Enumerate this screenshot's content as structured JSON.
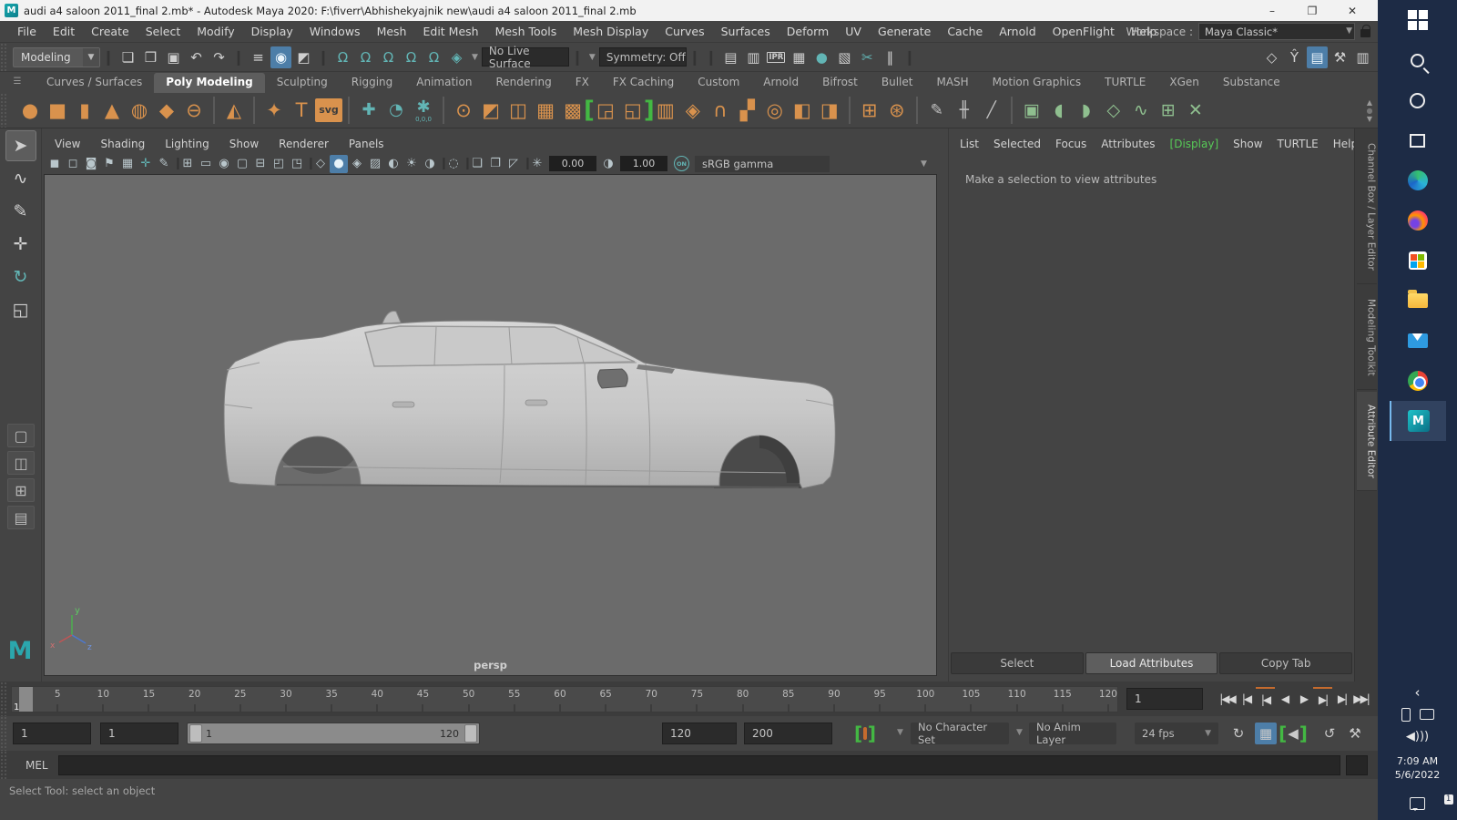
{
  "window": {
    "title": "audi a4 saloon 2011_final 2.mb* - Autodesk Maya 2020: F:\\fiverr\\Abhishekyajnik new\\audi a4 saloon 2011_final 2.mb",
    "minimize": "–",
    "maximize": "❐",
    "close": "✕"
  },
  "menu_bar": {
    "items": [
      "File",
      "Edit",
      "Create",
      "Select",
      "Modify",
      "Display",
      "Windows",
      "Mesh",
      "Edit Mesh",
      "Mesh Tools",
      "Mesh Display",
      "Curves",
      "Surfaces",
      "Deform",
      "UV",
      "Generate",
      "Cache",
      "Arnold",
      "OpenFlight",
      "Help"
    ],
    "workspace_label": "Workspace :",
    "workspace_value": "Maya Classic*"
  },
  "status_line": {
    "mode_selector": "Modeling",
    "file_icons": [
      {
        "name": "new-scene-icon",
        "glyph": "❏"
      },
      {
        "name": "open-scene-icon",
        "glyph": "❒"
      },
      {
        "name": "save-scene-icon",
        "glyph": "▣"
      },
      {
        "name": "undo-icon",
        "glyph": "↶"
      },
      {
        "name": "redo-icon",
        "glyph": "↷"
      }
    ],
    "selection_icons": [
      {
        "name": "select-hierarchy-icon",
        "glyph": "≡",
        "active": false
      },
      {
        "name": "select-object-icon",
        "glyph": "◉",
        "active": true
      },
      {
        "name": "select-component-icon",
        "glyph": "◩",
        "active": false
      }
    ],
    "snap_icons": [
      {
        "name": "snap-grid-icon",
        "glyph": "Ω"
      },
      {
        "name": "snap-curve-icon",
        "glyph": "Ω"
      },
      {
        "name": "snap-point-icon",
        "glyph": "Ω"
      },
      {
        "name": "snap-projected-center-icon",
        "glyph": "Ω"
      },
      {
        "name": "snap-view-plane-icon",
        "glyph": "Ω"
      },
      {
        "name": "make-live-icon",
        "glyph": "◈"
      }
    ],
    "no_live_surface": "No Live Surface",
    "symmetry": "Symmetry: Off",
    "render_icons": [
      {
        "name": "render-view-icon",
        "glyph": "▤"
      },
      {
        "name": "render-current-frame-icon",
        "glyph": "▥"
      },
      {
        "name": "ipr-render-icon",
        "glyph": "IPR"
      },
      {
        "name": "render-settings-icon",
        "glyph": "▦"
      },
      {
        "name": "display-render-settings-icon",
        "glyph": "●",
        "teal": true
      },
      {
        "name": "render-sequence-icon",
        "glyph": "▧"
      },
      {
        "name": "launch-render-setup-icon",
        "glyph": "✂",
        "teal": true
      },
      {
        "name": "pause-viewport-icon",
        "glyph": "‖"
      }
    ],
    "sidebar_icons": [
      {
        "name": "modeling-toolkit-icon",
        "glyph": "◇",
        "active": false
      },
      {
        "name": "humanik-icon",
        "glyph": "Ŷ",
        "active": false
      },
      {
        "name": "attribute-editor-icon",
        "glyph": "▤",
        "active": true
      },
      {
        "name": "tool-settings-icon",
        "glyph": "⚒",
        "active": false
      },
      {
        "name": "channel-box-icon",
        "glyph": "▥",
        "active": false
      }
    ]
  },
  "shelf": {
    "tabs": [
      "Curves / Surfaces",
      "Poly Modeling",
      "Sculpting",
      "Rigging",
      "Animation",
      "Rendering",
      "FX",
      "FX Caching",
      "Custom",
      "Arnold",
      "Bifrost",
      "Bullet",
      "MASH",
      "Motion Graphics",
      "TURTLE",
      "XGen",
      "Substance"
    ],
    "active_tab": "Poly Modeling",
    "icons": [
      {
        "name": "poly-sphere-icon",
        "glyph": "●",
        "color": "orange"
      },
      {
        "name": "poly-cube-icon",
        "glyph": "■",
        "color": "orange"
      },
      {
        "name": "poly-cylinder-icon",
        "glyph": "▮",
        "color": "orange"
      },
      {
        "name": "poly-cone-icon",
        "glyph": "▲",
        "color": "orange"
      },
      {
        "name": "poly-torus-icon",
        "glyph": "◍",
        "color": "orange"
      },
      {
        "name": "poly-plane-icon",
        "glyph": "◆",
        "color": "orange"
      },
      {
        "name": "poly-disc-icon",
        "glyph": "⊖",
        "color": "orange"
      },
      {
        "sep": true
      },
      {
        "name": "platonic-solid-icon",
        "glyph": "◭",
        "color": "orange"
      },
      {
        "sep": true
      },
      {
        "name": "sweep-mesh-icon",
        "glyph": "✦",
        "color": "orange"
      },
      {
        "name": "poly-type-icon",
        "glyph": "T",
        "color": "orange"
      },
      {
        "name": "svg-tool-icon",
        "glyph": "svg",
        "color": "orange",
        "badge": true
      },
      {
        "sep": true
      },
      {
        "name": "construction-plane-icon",
        "glyph": "✚",
        "color": "teal"
      },
      {
        "name": "reset-transform-icon",
        "glyph": "◔",
        "color": "teal"
      },
      {
        "name": "move-to-origin-icon",
        "glyph": "✱",
        "color": "teal",
        "sub": "0,0,0"
      },
      {
        "sep": true
      },
      {
        "name": "booleans-icon",
        "glyph": "⊙",
        "color": "orange"
      },
      {
        "name": "combine-icon",
        "glyph": "◩",
        "color": "orange"
      },
      {
        "name": "mirror-icon",
        "glyph": "◫",
        "color": "orange"
      },
      {
        "name": "smooth-icon",
        "glyph": "▦",
        "color": "orange"
      },
      {
        "name": "subdivide-icon",
        "glyph": "▩",
        "color": "orange"
      },
      {
        "name": "rotate-edge-cw-icon",
        "glyph": "◲",
        "color": "orange",
        "bracket": "left"
      },
      {
        "name": "rotate-edge-ccw-icon",
        "glyph": "◱",
        "color": "orange",
        "bracket": "right"
      },
      {
        "name": "extrude-icon",
        "glyph": "▥",
        "color": "orange"
      },
      {
        "name": "bevel-icon",
        "glyph": "◈",
        "color": "orange"
      },
      {
        "name": "bridge-icon",
        "glyph": "∩",
        "color": "orange"
      },
      {
        "name": "multi-cut-icon",
        "glyph": "▞",
        "color": "orange"
      },
      {
        "name": "circularize-icon",
        "glyph": "◎",
        "color": "orange"
      },
      {
        "name": "quad-draw-icon",
        "glyph": "◧",
        "color": "orange"
      },
      {
        "name": "target-weld-icon",
        "glyph": "◨",
        "color": "orange"
      },
      {
        "sep": true
      },
      {
        "name": "lattice-icon",
        "glyph": "⊞",
        "color": "orange"
      },
      {
        "name": "soft-modification-icon",
        "glyph": "⊛",
        "color": "orange"
      },
      {
        "sep": true
      },
      {
        "name": "crease-tool-icon",
        "glyph": "✎",
        "color": "grey"
      },
      {
        "name": "edit-edge-flow-icon",
        "glyph": "╫",
        "color": "grey"
      },
      {
        "name": "insert-edge-loop-icon",
        "glyph": "╱",
        "color": "grey"
      },
      {
        "sep": true
      },
      {
        "name": "uv-planar-icon",
        "glyph": "▣",
        "color": "green"
      },
      {
        "name": "uv-cylindrical-icon",
        "glyph": "◖",
        "color": "green"
      },
      {
        "name": "uv-spherical-icon",
        "glyph": "◗",
        "color": "green"
      },
      {
        "name": "uv-automatic-icon",
        "glyph": "◇",
        "color": "green"
      },
      {
        "name": "uv-contour-stretch-icon",
        "glyph": "∿",
        "color": "green"
      },
      {
        "name": "uv-editor-icon",
        "glyph": "⊞",
        "color": "green"
      },
      {
        "name": "uv-cut-sew-icon",
        "glyph": "✕",
        "color": "green"
      }
    ]
  },
  "toolbox": {
    "tools": [
      {
        "name": "select-tool",
        "glyph": "➤",
        "active": true
      },
      {
        "name": "lasso-tool",
        "glyph": "∿",
        "active": false
      },
      {
        "name": "paint-select-tool",
        "glyph": "✎",
        "active": false
      },
      {
        "name": "move-tool",
        "glyph": "✛",
        "active": false
      },
      {
        "name": "rotate-tool",
        "glyph": "↻",
        "active": false,
        "teal": true
      },
      {
        "name": "scale-tool",
        "glyph": "◱",
        "active": false
      }
    ],
    "layout_buttons": [
      {
        "name": "pane-layout-single-icon",
        "glyph": "▢"
      },
      {
        "name": "pane-layout-two-icon",
        "glyph": "◫"
      },
      {
        "name": "pane-layout-four-icon",
        "glyph": "⊞"
      },
      {
        "name": "pane-layout-outliner-icon",
        "glyph": "▤"
      }
    ]
  },
  "viewport": {
    "menus": [
      "View",
      "Shading",
      "Lighting",
      "Show",
      "Renderer",
      "Panels"
    ],
    "toolbar_icons": [
      {
        "name": "select-camera-icon",
        "glyph": "◼"
      },
      {
        "name": "lock-camera-icon",
        "glyph": "◻"
      },
      {
        "name": "camera-attributes-icon",
        "glyph": "◙"
      },
      {
        "name": "bookmark-icon",
        "glyph": "⚑"
      },
      {
        "name": "image-plane-icon",
        "glyph": "▦"
      },
      {
        "name": "pan-zoom-icon",
        "glyph": "✛",
        "teal": true
      },
      {
        "name": "grease-pencil-icon",
        "glyph": "✎"
      },
      {
        "sep": true
      },
      {
        "name": "grid-icon",
        "glyph": "⊞"
      },
      {
        "name": "film-gate-icon",
        "glyph": "▭"
      },
      {
        "name": "resolution-gate-icon",
        "glyph": "◉"
      },
      {
        "name": "gate-mask-icon",
        "glyph": "▢"
      },
      {
        "name": "field-chart-icon",
        "glyph": "⊟"
      },
      {
        "name": "safe-action-icon",
        "glyph": "◰"
      },
      {
        "name": "safe-title-icon",
        "glyph": "◳"
      },
      {
        "sep": true
      },
      {
        "name": "wireframe-icon",
        "glyph": "◇"
      },
      {
        "name": "smooth-shade-icon",
        "glyph": "●",
        "active": true
      },
      {
        "name": "wireframe-on-shaded-icon",
        "glyph": "◈"
      },
      {
        "name": "textured-icon",
        "glyph": "▨"
      },
      {
        "name": "use-default-material-icon",
        "glyph": "◐"
      },
      {
        "name": "lighting-icon",
        "glyph": "☀"
      },
      {
        "name": "shadows-icon",
        "glyph": "◑"
      },
      {
        "sep": true
      },
      {
        "name": "isolate-select-icon",
        "glyph": "◌"
      },
      {
        "sep": true
      },
      {
        "name": "xray-icon",
        "glyph": "❏"
      },
      {
        "name": "ghosting-icon",
        "glyph": "❐"
      },
      {
        "name": "backface-icon",
        "glyph": "◸"
      },
      {
        "sep": true
      },
      {
        "name": "exposure-icon",
        "glyph": "✳"
      }
    ],
    "exposure_value": "0.00",
    "contrast_icon": "◑",
    "contrast_value": "1.00",
    "on_badge": "ON",
    "color_transform": "sRGB gamma",
    "camera_label": "persp",
    "axis_labels": {
      "y": "y",
      "x": "x",
      "z": "z"
    }
  },
  "attribute_editor": {
    "menus": [
      "List",
      "Selected",
      "Focus",
      "Attributes",
      "Display",
      "Show",
      "TURTLE",
      "Help"
    ],
    "bracketed_menu": "Display",
    "message": "Make a selection to view attributes",
    "buttons": [
      {
        "label": "Select",
        "focused": false
      },
      {
        "label": "Load Attributes",
        "focused": true
      },
      {
        "label": "Copy Tab",
        "focused": false
      }
    ],
    "side_tabs": [
      {
        "label": "Channel Box / Layer Editor",
        "active": false
      },
      {
        "label": "Modeling Toolkit",
        "active": false
      },
      {
        "label": "Attribute Editor",
        "active": true
      }
    ]
  },
  "timeline": {
    "ticks": [
      5,
      10,
      15,
      20,
      25,
      30,
      35,
      40,
      45,
      50,
      55,
      60,
      65,
      70,
      75,
      80,
      85,
      90,
      95,
      100,
      105,
      110,
      115,
      120
    ],
    "current_frame": "1",
    "current_time_field": "1",
    "playback_buttons": [
      {
        "name": "go-to-start-button",
        "glyph": "|◀◀"
      },
      {
        "name": "step-back-frame-button",
        "glyph": "|◀"
      },
      {
        "name": "step-back-key-button",
        "glyph": "|◀",
        "keyed": true
      },
      {
        "name": "play-backwards-button",
        "glyph": "◀"
      },
      {
        "name": "play-forwards-button",
        "glyph": "▶"
      },
      {
        "name": "step-forward-key-button",
        "glyph": "▶|",
        "keyed": true
      },
      {
        "name": "step-forward-frame-button",
        "glyph": "▶|"
      },
      {
        "name": "go-to-end-button",
        "glyph": "▶▶|"
      }
    ]
  },
  "range_bar": {
    "animation_start": "1",
    "playback_start": "1",
    "range_start_label": "1",
    "range_end_label": "120",
    "playback_end": "120",
    "animation_end": "200",
    "character_set": "No Character Set",
    "anim_layer": "No Anim Layer",
    "fps": "24 fps"
  },
  "command_line": {
    "label": "MEL"
  },
  "help_line": {
    "text": "Select Tool: select an object"
  },
  "taskbar": {
    "apps": [
      {
        "name": "start-button",
        "kind": "start"
      },
      {
        "name": "search-icon",
        "kind": "search"
      },
      {
        "name": "cortana-icon",
        "kind": "ring"
      },
      {
        "name": "task-view-icon",
        "kind": "task"
      },
      {
        "name": "edge-icon",
        "kind": "edge"
      },
      {
        "name": "firefox-icon",
        "kind": "ff"
      },
      {
        "name": "store-icon",
        "kind": "store"
      },
      {
        "name": "file-explorer-icon",
        "kind": "folder"
      },
      {
        "name": "mail-icon",
        "kind": "mail"
      },
      {
        "name": "chrome-icon",
        "kind": "chrome"
      },
      {
        "name": "maya-app-icon",
        "kind": "maya",
        "label": "M",
        "active": true
      }
    ],
    "tray": {
      "chevron": "‹",
      "clock_time": "7:09 AM",
      "clock_date": "5/6/2022",
      "notification_badge": "1"
    }
  },
  "colors": {
    "panel_bg": "#444444",
    "field_bg": "#2a2a2a",
    "accent_blue": "#4d7ea8",
    "shelf_orange": "#d9924d",
    "snap_teal": "#62b5b5",
    "uv_green": "#8fbf8f",
    "bracket_green": "#43b843",
    "viewport_grey": "#6b6b6b",
    "taskbar_navy": "#1d2b45",
    "car_grey": "#cccccc"
  }
}
